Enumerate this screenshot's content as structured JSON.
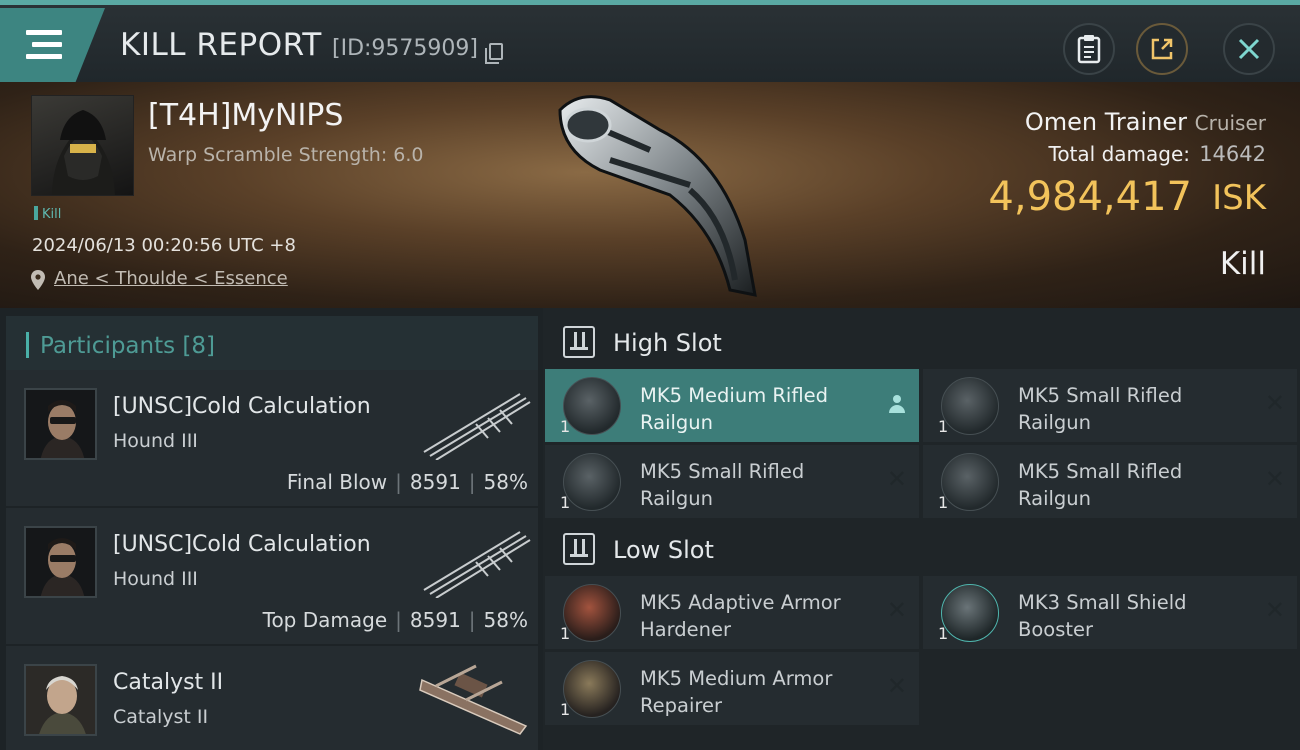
{
  "header": {
    "title": "KILL REPORT",
    "report_id": "[ID:9575909]"
  },
  "victim": {
    "name": "[T4H]MyNIPS",
    "subtitle": "Warp Scramble Strength: 6.0",
    "tag": "Kill",
    "datetime": "2024/06/13 00:20:56 UTC +8",
    "location": "Ane < Thoulde < Essence",
    "ship_name": "Omen Trainer",
    "ship_class": "Cruiser",
    "total_damage_label": "Total damage:",
    "total_damage": "14642",
    "isk_value": "4,984,417",
    "isk_unit": "ISK",
    "result": "Kill"
  },
  "participants": {
    "label": "Participants",
    "count": "[8]",
    "rows": [
      {
        "name": "[UNSC]Cold Calculation",
        "ship": "Hound III",
        "role": "Final Blow",
        "damage": "8591",
        "percent": "58%"
      },
      {
        "name": "[UNSC]Cold Calculation",
        "ship": "Hound III",
        "role": "Top Damage",
        "damage": "8591",
        "percent": "58%"
      },
      {
        "name": "Catalyst II",
        "ship": "Catalyst II",
        "role": "",
        "damage": "",
        "percent": ""
      }
    ]
  },
  "fitting": {
    "high_slot_label": "High Slot",
    "low_slot_label": "Low Slot",
    "high": [
      {
        "name": "MK5 Medium Rifled Railgun",
        "qty": "1"
      },
      {
        "name": "MK5 Small Rifled Railgun",
        "qty": "1"
      },
      {
        "name": "MK5 Small Rifled Railgun",
        "qty": "1"
      },
      {
        "name": "MK5 Small Rifled Railgun",
        "qty": "1"
      }
    ],
    "low": [
      {
        "name": "MK5 Adaptive Armor Hardener",
        "qty": "1"
      },
      {
        "name": "MK3 Small Shield Booster",
        "qty": "1"
      },
      {
        "name": "MK5 Medium Armor Repairer",
        "qty": "1"
      }
    ]
  },
  "icons": {
    "menu": "menu-icon",
    "copy": "copy-icon",
    "clipboard": "clipboard-icon",
    "share": "share-icon",
    "close": "close-icon",
    "location": "location-pin-icon",
    "slot": "slot-icon",
    "destroyed": "close-icon",
    "dropped": "person-icon"
  },
  "colors": {
    "accent": "#4ab0a8",
    "isk": "#f2c35b",
    "highlight_row": "#3d7d79"
  }
}
